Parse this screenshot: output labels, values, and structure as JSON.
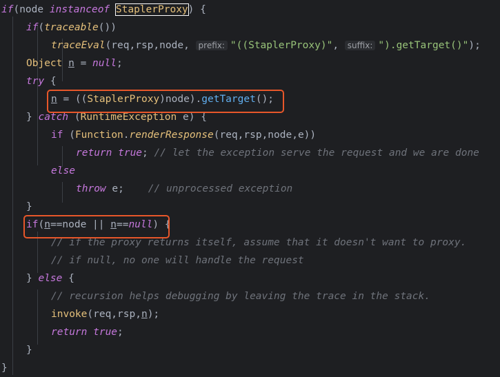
{
  "editor": {
    "lines": [
      {
        "t": [
          "if",
          "(",
          "node ",
          "instanceof ",
          "StaplerProxy",
          ") {"
        ]
      },
      {
        "t": [
          "if",
          "(",
          "traceable",
          "())"
        ]
      },
      {
        "t": [
          "traceEval",
          "(req,rsp,node, ",
          "prefix:",
          "\"((StaplerProxy)\"",
          ", ",
          "suffix:",
          "\").getTarget()\"",
          ");"
        ]
      },
      {
        "t": [
          "Object ",
          "n",
          " = ",
          "null",
          ";"
        ]
      },
      {
        "t": [
          "try",
          " {"
        ]
      },
      {
        "t": [
          "n",
          " = ((",
          "Stapler",
          "Proxy",
          ")node).",
          "getTarget",
          "();"
        ]
      },
      {
        "t": [
          "} ",
          "catch",
          " (",
          "RuntimeException",
          " e) {"
        ]
      },
      {
        "t": [
          "if",
          " (",
          "Function",
          ".",
          "renderResponse",
          "(req,rsp,node,e))"
        ]
      },
      {
        "t": [
          "return true",
          "; ",
          "// let the exception serve the request and we are done"
        ]
      },
      {
        "t": [
          "else"
        ]
      },
      {
        "t": [
          "throw",
          " e;    ",
          "// unprocessed exception"
        ]
      },
      {
        "t": [
          "}"
        ]
      },
      {
        "t": [
          "if",
          "(",
          "n",
          "==node || ",
          "n",
          "==",
          "null",
          ")",
          " {"
        ]
      },
      {
        "t": [
          "// if the proxy returns itself, assume that it doesn't want to proxy."
        ]
      },
      {
        "t": [
          "// if null, no one will handle the request"
        ]
      },
      {
        "t": [
          "} ",
          "else",
          " {"
        ]
      },
      {
        "t": [
          "// recursion helps debugging by leaving the trace in the stack."
        ]
      },
      {
        "t": [
          "invoke",
          "(req,rsp,",
          "n",
          ");"
        ]
      },
      {
        "t": [
          "return true",
          ";"
        ]
      },
      {
        "t": [
          "}"
        ]
      },
      {
        "t": [
          "}"
        ]
      }
    ]
  }
}
